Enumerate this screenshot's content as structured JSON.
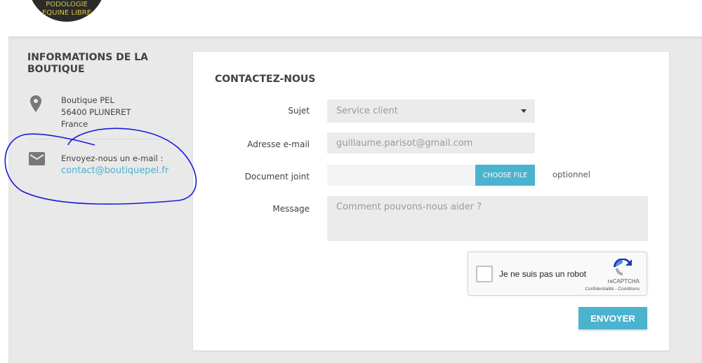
{
  "logo": {
    "line1": "PODOLOGIE",
    "line2": "EQUINE LIBRE"
  },
  "store_info": {
    "title": "INFORMATIONS DE LA BOUTIQUE",
    "address": [
      "Boutique PEL",
      "56400 PLUNERET",
      "France"
    ],
    "email_label": "Envoyez-nous un e-mail :",
    "email": "contact@boutiquepel.fr"
  },
  "form": {
    "title": "CONTACTEZ-NOUS",
    "subject_label": "Sujet",
    "subject_value": "Service client",
    "email_label": "Adresse e-mail",
    "email_value": "guillaume.parisot@gmail.com",
    "attachment_label": "Document joint",
    "choose_file": "CHOOSE FILE",
    "optional": "optionnel",
    "message_label": "Message",
    "message_placeholder": "Comment pouvons-nous aider ?",
    "captcha": {
      "label": "Je ne suis pas un robot",
      "brand": "reCAPTCHA",
      "links": "Confidentialité - Conditions"
    },
    "submit": "ENVOYER"
  },
  "colors": {
    "accent": "#4cb3cf",
    "annotation": "#1a1adc"
  }
}
